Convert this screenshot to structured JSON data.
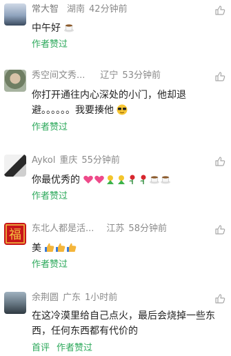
{
  "comments": [
    {
      "user": "常大智",
      "location": "湖南",
      "time": "42分钟前",
      "text": "中午好",
      "emojis": "coffee",
      "footer": [
        "作者赞过"
      ]
    },
    {
      "user": "秀空间文秀...",
      "location": "辽宁",
      "time": "53分钟前",
      "text": "你打开通往内心深处的小门，他却退避。。。。。。我要揍他",
      "emojis": "sunglasses",
      "footer": [
        "作者赞过"
      ]
    },
    {
      "user": "Aykol",
      "location": "重庆",
      "time": "55分钟前",
      "text": "你最优秀的",
      "emojis": "hearts-bouquets-roses-coffee",
      "footer": [
        "作者赞过"
      ]
    },
    {
      "user": "东北人都是活...",
      "location": "江苏",
      "time": "58分钟前",
      "text": "美",
      "emojis": "thumbs-up",
      "footer": [
        "作者赞过"
      ]
    },
    {
      "user": "余荆圆",
      "location": "广东",
      "time": "1小时前",
      "text": "在这冷漠里给自己点火，最后会烧掉一些东西，任何东西都有代价的",
      "emojis": "",
      "footer": [
        "首评",
        "作者赞过"
      ]
    }
  ],
  "colors": {
    "meta": "#8a8a8a",
    "text": "#222222",
    "accent": "#2ba85a",
    "icon": "#a8a8a8"
  },
  "icons": {
    "like": "thumb-up-outline-icon"
  }
}
